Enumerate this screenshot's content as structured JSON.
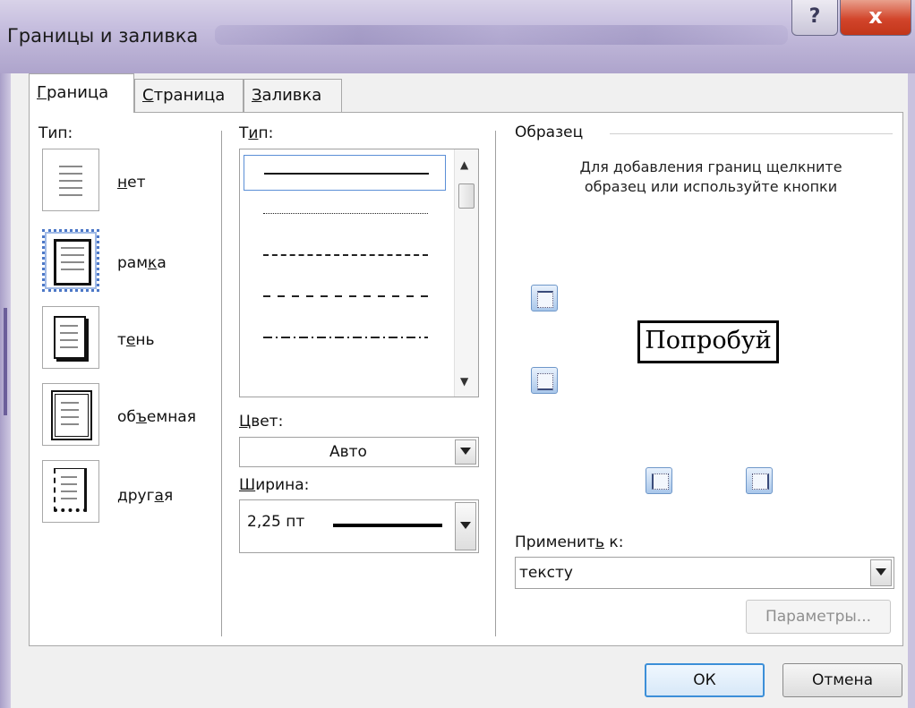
{
  "window": {
    "title": "Границы и заливка",
    "help_label": "?",
    "close_label": "x"
  },
  "tabs": [
    {
      "label_pre": "",
      "label_u": "Г",
      "label_post": "раница",
      "active": true
    },
    {
      "label_pre": "",
      "label_u": "С",
      "label_post": "траница",
      "active": false
    },
    {
      "label_pre": "",
      "label_u": "З",
      "label_post": "аливка",
      "active": false
    }
  ],
  "setting": {
    "label": "Тип:",
    "items": [
      {
        "pre": "",
        "u": "н",
        "post": "ет"
      },
      {
        "pre": "рам",
        "u": "к",
        "post": "а"
      },
      {
        "pre": "т",
        "u": "е",
        "post": "нь"
      },
      {
        "pre": "об",
        "u": "ъ",
        "post": "емная"
      },
      {
        "pre": "друг",
        "u": "а",
        "post": "я"
      }
    ]
  },
  "style": {
    "label_pre": "Т",
    "label_u": "и",
    "label_post": "п:",
    "lines": [
      "solid",
      "dotted",
      "fine-dashed",
      "dashed",
      "dash-dot"
    ]
  },
  "color": {
    "label_pre": "",
    "label_u": "Ц",
    "label_post": "вет:",
    "value": "Авто"
  },
  "width": {
    "label_pre": "",
    "label_u": "Ш",
    "label_post": "ирина:",
    "value": "2,25 пт"
  },
  "preview": {
    "title": "Образец",
    "hint": "Для добавления границ щелкните образец или используйте кнопки",
    "sample_text": "Попробуй"
  },
  "apply": {
    "label_pre": "Применит",
    "label_u": "ь",
    "label_post": " к:",
    "value": "тексту"
  },
  "buttons": {
    "params": "Параметры...",
    "ok": "ОК",
    "cancel": "Отмена"
  }
}
